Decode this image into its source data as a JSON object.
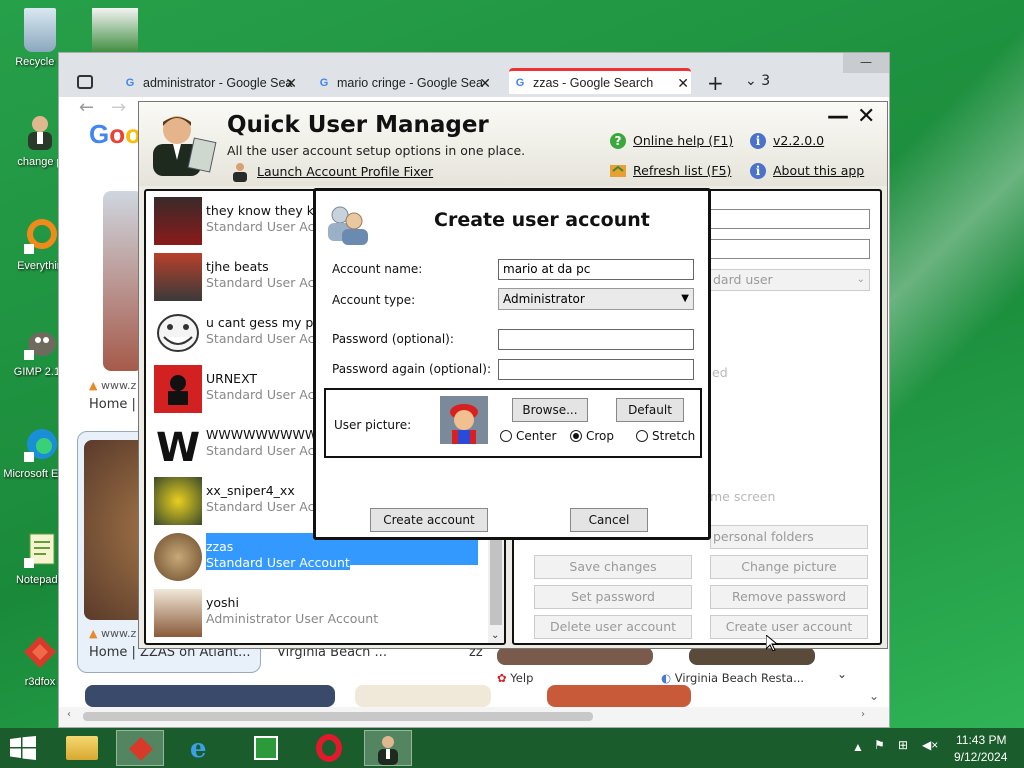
{
  "desktop_icons": [
    {
      "label": "Recycle B",
      "icon": "recycle-bin-icon"
    },
    {
      "label": "change p",
      "icon": "user-icon"
    },
    {
      "label": "Everythin",
      "icon": "search-ring-icon"
    },
    {
      "label": "GIMP 2.10",
      "icon": "gimp-icon"
    },
    {
      "label": "Microsoft Edge",
      "icon": "edge-icon"
    },
    {
      "label": "Notepad+",
      "icon": "notepad-icon"
    },
    {
      "label": "r3dfox",
      "icon": "r3dfox-icon"
    }
  ],
  "browser": {
    "tabs": [
      {
        "title": "administrator - Google Sea"
      },
      {
        "title": "mario cringe - Google Sea"
      },
      {
        "title": "zzas - Google Search",
        "active": true
      }
    ],
    "tab_count": "3",
    "page_frags": {
      "site1": "www.z",
      "home1": "Home |",
      "site2": "www.z",
      "home2": "Home | ZZAS on Atlant...",
      "vb": "Virginia Beach ...",
      "zz": "zz",
      "yelp": "Yelp",
      "vbr": "Virginia Beach Resta..."
    }
  },
  "app": {
    "title": "Quick User Manager",
    "subtitle": "All the user account setup options in one place.",
    "launch_link": "Launch Account Profile Fixer",
    "online_help": "Online help (F1)",
    "version": "v2.2.0.0",
    "refresh": "Refresh list (F5)",
    "about": "About this app",
    "min": "—",
    "close": "✕"
  },
  "users": [
    {
      "name": "they know they kn",
      "type": "Standard User Acc",
      "color": "#8a1a1a"
    },
    {
      "name": "tjhe beats",
      "type": "Standard User Acc",
      "color": "#556b2f"
    },
    {
      "name": "u cant gess my pa",
      "type": "Standard User Acc",
      "color": "#dddddd"
    },
    {
      "name": "URNEXT",
      "type": "Standard User Acc",
      "color": "#d32020"
    },
    {
      "name": "WWWWWWWWWW",
      "type": "Standard User Acc",
      "color": "#ffffff"
    },
    {
      "name": "xx_sniper4_xx",
      "type": "Standard User Acc",
      "color": "#6b8e23"
    },
    {
      "name": "zzas",
      "type": "Standard User Account",
      "color": "#b08a5a",
      "selected": true
    },
    {
      "name": "yoshi",
      "type": "Administrator User Account",
      "color": "#e8e0d0"
    }
  ],
  "right_panel": {
    "type_value": "dard user",
    "frag_ed": "ed",
    "frag_screen": "me screen",
    "personal_folders": "personal folders",
    "save_changes": "Save changes",
    "change_picture": "Change picture",
    "set_password": "Set password",
    "remove_password": "Remove password",
    "delete_user": "Delete user account",
    "create_user": "Create user account"
  },
  "dialog": {
    "title": "Create user account",
    "account_name_label": "Account name:",
    "account_name_value": "mario at da pc",
    "account_type_label": "Account type:",
    "account_type_value": "Administrator",
    "password_label": "Password (optional):",
    "password_again_label": "Password again (optional):",
    "user_picture_label": "User picture:",
    "browse": "Browse...",
    "default": "Default",
    "center": "Center",
    "crop": "Crop",
    "stretch": "Stretch",
    "selected_fit": "crop",
    "create": "Create account",
    "cancel": "Cancel"
  },
  "tray": {
    "time": "11:43 PM",
    "date": "9/12/2024"
  }
}
